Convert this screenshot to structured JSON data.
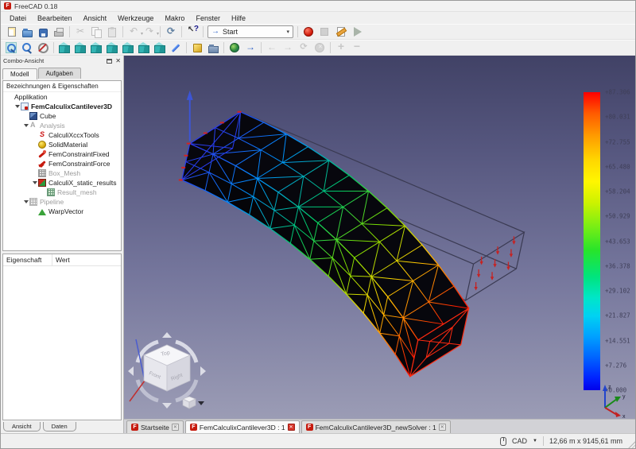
{
  "window": {
    "title": "FreeCAD 0.18"
  },
  "menubar": [
    "Datei",
    "Bearbeiten",
    "Ansicht",
    "Werkzeuge",
    "Makro",
    "Fenster",
    "Hilfe"
  ],
  "toolbars": {
    "workbench_selected": "Start",
    "row_standard": [
      "new-file",
      "open-file",
      "save-file",
      "print",
      "|",
      "cut",
      "copy",
      "paste",
      "|",
      "undo",
      "redo",
      "|",
      "refresh",
      "|",
      "whats-this"
    ],
    "row_macro": [
      "macro-record",
      "macro-stop",
      "macro-edit",
      "macro-play"
    ],
    "row_view": [
      "fit-all",
      "zoom-select",
      "draw-style",
      "|",
      "view-axonometric",
      "view-front",
      "view-top",
      "view-right",
      "view-rear",
      "view-bottom",
      "view-left",
      "measure",
      "|",
      "open-start",
      "open-folder",
      "|",
      "web-home",
      "web-forward",
      "|",
      "nav-back",
      "nav-forward",
      "nav-refresh",
      "nav-stop",
      "|",
      "zoom-in",
      "zoom-out"
    ],
    "disabled": [
      "cut",
      "copy",
      "paste",
      "undo",
      "redo",
      "macro-stop",
      "nav-back",
      "nav-forward",
      "nav-refresh",
      "nav-stop",
      "zoom-in",
      "zoom-out"
    ]
  },
  "combo_view": {
    "title": "Combo-Ansicht",
    "tabs": [
      "Modell",
      "Aufgaben"
    ],
    "tree_header": "Bezeichnungen & Eigenschaften",
    "tree": [
      {
        "label": "Applikation",
        "level": 0,
        "icon": "none"
      },
      {
        "label": "FemCalculixCantilever3D",
        "level": 1,
        "icon": "doc",
        "chevron": true,
        "bold": true
      },
      {
        "label": "Cube",
        "level": 2,
        "icon": "cube"
      },
      {
        "label": "Analysis",
        "level": 2,
        "icon": "analysis",
        "chevron": true,
        "gray": true
      },
      {
        "label": "CalculiXccxTools",
        "level": 3,
        "icon": "ccx"
      },
      {
        "label": "SolidMaterial",
        "level": 3,
        "icon": "material"
      },
      {
        "label": "FemConstraintFixed",
        "level": 3,
        "icon": "constraint-fixed"
      },
      {
        "label": "FemConstraintForce",
        "level": 3,
        "icon": "constraint-force"
      },
      {
        "label": "Box_Mesh",
        "level": 3,
        "icon": "mesh-gray",
        "gray": true
      },
      {
        "label": "CalculiX_static_results",
        "level": 3,
        "icon": "results",
        "chevron": true
      },
      {
        "label": "Result_mesh",
        "level": 4,
        "icon": "mesh-green",
        "gray": true
      },
      {
        "label": "Pipeline",
        "level": 2,
        "icon": "pipeline",
        "chevron": true,
        "gray": true
      },
      {
        "label": "WarpVector",
        "level": 3,
        "icon": "warp"
      }
    ]
  },
  "properties": {
    "columns": [
      "Eigenschaft",
      "Wert"
    ]
  },
  "panel_tabs": [
    "Ansicht",
    "Daten"
  ],
  "viewport": {
    "colorbar_labels": [
      "+87.306",
      "+80.031",
      "+72.755",
      "+65.480",
      "+58.204",
      "+50.929",
      "+43.653",
      "+36.378",
      "+29.102",
      "+21.827",
      "+14.551",
      "+7.276",
      "+0.000"
    ],
    "navcube_faces": [
      "Top",
      "Front",
      "Right"
    ],
    "axis_labels": [
      "z",
      "y",
      "x"
    ]
  },
  "mdi_tabs": [
    {
      "label": "Startseite",
      "active": false
    },
    {
      "label": "FemCalculixCantilever3D : 1",
      "active": true
    },
    {
      "label": "FemCalculixCantilever3D_newSolver : 1",
      "active": false
    }
  ],
  "statusbar": {
    "mode": "CAD",
    "dimensions": "12,66 m x 9145,61 mm"
  }
}
